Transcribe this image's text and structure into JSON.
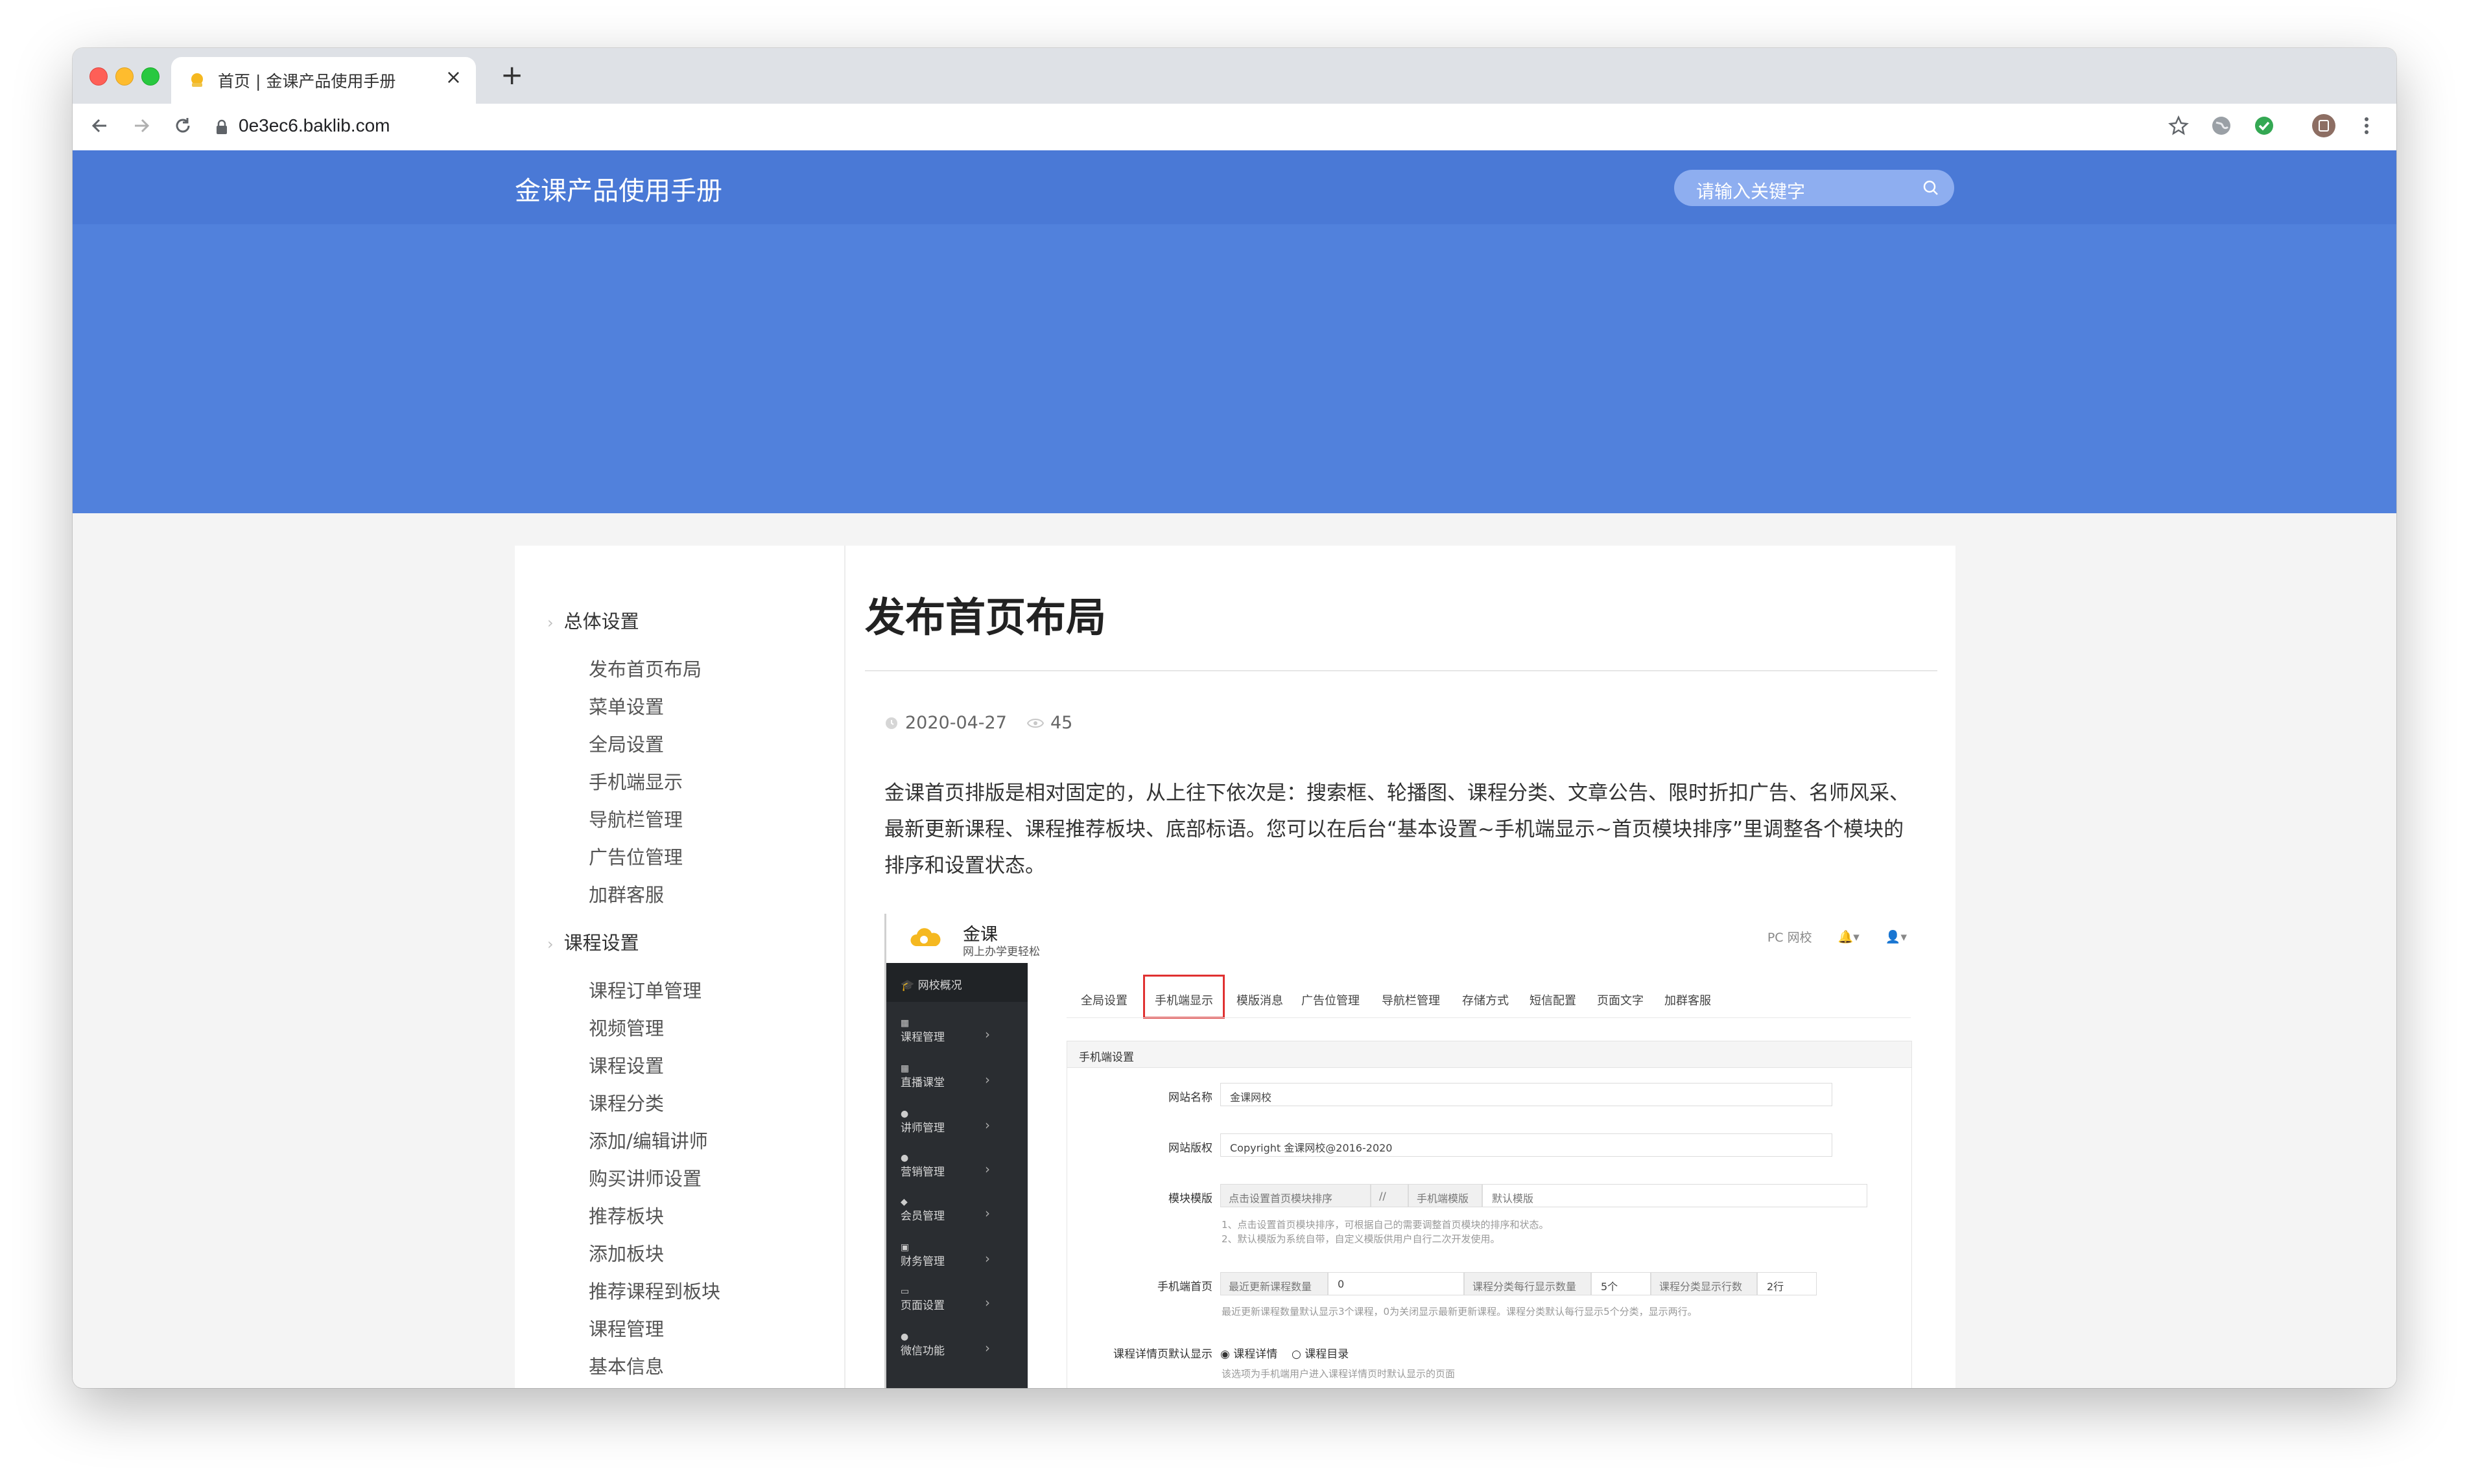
{
  "browser": {
    "tab_title": "首页 | 金课产品使用手册",
    "url": "0e3ec6.baklib.com",
    "new_tab_symbol": "+",
    "close_symbol": "×"
  },
  "site": {
    "title": "金课产品使用手册",
    "search_placeholder": "请输入关键字"
  },
  "sidebar": {
    "sections": [
      {
        "label": "总体设置",
        "items": [
          "发布首页布局",
          "菜单设置",
          "全局设置",
          "手机端显示",
          "导航栏管理",
          "广告位管理",
          "加群客服"
        ]
      },
      {
        "label": "课程设置",
        "items": [
          "课程订单管理",
          "视频管理",
          "课程设置",
          "课程分类",
          "添加/编辑讲师",
          "购买讲师设置",
          "推荐板块",
          "添加板块",
          "推荐课程到板块",
          "课程管理",
          "基本信息"
        ]
      }
    ]
  },
  "article": {
    "title": "发布首页布局",
    "date": "2020-04-27",
    "views": "45",
    "paragraph": "金课首页排版是相对固定的，从上往下依次是：搜索框、轮播图、课程分类、文章公告、限时折扣广告、名师风采、最新更新课程、课程推荐板块、底部标语。您可以在后台“基本设置~手机端显示~首页模块排序”里调整各个模块的排序和设置状态。"
  },
  "screenshot": {
    "brand": "金课",
    "brand_sub": "网上办学更轻松",
    "top_right_label": "PC 网校",
    "side_items": [
      "网校概况",
      "课程管理",
      "直播课堂",
      "讲师管理",
      "营销管理",
      "会员管理",
      "财务管理",
      "页面设置",
      "微信功能"
    ],
    "tabs": [
      "全局设置",
      "手机端显示",
      "模版消息",
      "广告位管理",
      "导航栏管理",
      "存储方式",
      "短信配置",
      "页面文字",
      "加群客服"
    ],
    "panel_title": "手机端设置",
    "labels": {
      "site_name": "网站名称",
      "copyright": "网站版权",
      "module_template": "模块模版",
      "mobile_home": "手机端首页",
      "detail_default": "课程详情页默认显示"
    },
    "values": {
      "site_name": "金课网校",
      "copyright": "Copyright 金课网校@2016-2020",
      "module_sort": "点击设置首页模块排序",
      "slash": "//",
      "mobile_template": "手机端模版",
      "default_template": "默认模版",
      "latest_count_label": "最近更新课程数量",
      "latest_count": "0",
      "per_row_label": "课程分类每行显示数量",
      "per_row": "5个",
      "rows_label": "课程分类显示行数",
      "rows": "2行",
      "radio_detail": "课程详情",
      "radio_catalog": "课程目录"
    },
    "hints": {
      "module_1": "1、点击设置首页模块排序，可根据自己的需要调整首页模块的排序和状态。",
      "module_2": "2、默认模版为系统自带，自定义模版供用户自行二次开发使用。",
      "home": "最近更新课程数量默认显示3个课程，0为关闭显示最新更新课程。课程分类默认每行显示5个分类，显示两行。",
      "detail": "该选项为手机端用户进入课程详情页时默认显示的页面"
    }
  },
  "colors": {
    "hero": "#5181dc",
    "header": "#4a79d6",
    "search_bg": "#8eaef0",
    "highlight": "#e03131"
  }
}
